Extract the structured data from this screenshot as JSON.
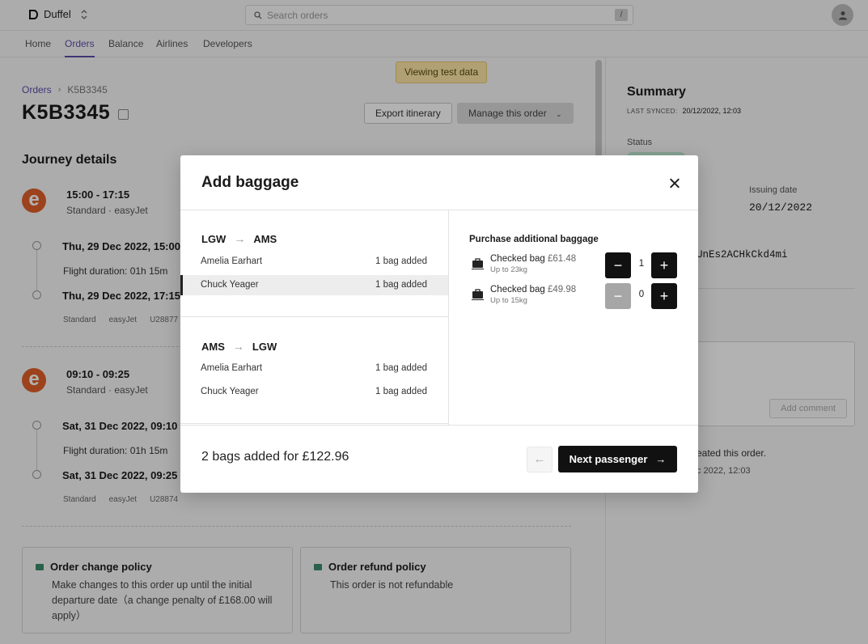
{
  "topbar": {
    "org_name": "Duffel",
    "search_placeholder": "Search orders",
    "search_shortcut": "/"
  },
  "nav": {
    "items": [
      "Home",
      "Orders",
      "Balance",
      "Airlines",
      "Developers"
    ],
    "active": "Orders"
  },
  "banner": "Viewing test data",
  "breadcrumb": {
    "root": "Orders",
    "current": "K5B3345"
  },
  "order": {
    "reference": "K5B3345",
    "export_label": "Export itinerary",
    "manage_label": "Manage this order"
  },
  "journey": {
    "title": "Journey details",
    "slices": [
      {
        "logo_letter": "e",
        "time": "15:00 - 17:15",
        "cabin_airline": "Standard · easyJet",
        "departure": "Thu, 29 Dec 2022, 15:00",
        "duration": "Flight duration: 01h 15m",
        "arrival": "Thu, 29 Dec 2022, 17:15",
        "meta": [
          "Standard",
          "easyJet",
          "U28877"
        ]
      },
      {
        "logo_letter": "e",
        "time": "09:10 - 09:25",
        "cabin_airline": "Standard · easyJet",
        "departure": "Sat, 31 Dec 2022, 09:10",
        "duration": "Flight duration: 01h 15m",
        "arrival": "Sat, 31 Dec 2022, 09:25",
        "meta": [
          "Standard",
          "easyJet",
          "U28874"
        ]
      }
    ]
  },
  "policies": {
    "change": {
      "title": "Order change policy",
      "text": "Make changes to this order up until the initial departure date（a change penalty of £168.00 will apply）"
    },
    "refund": {
      "title": "Order refund policy",
      "text": "This order is not refundable"
    }
  },
  "summary": {
    "title": "Summary",
    "last_synced_label": "LAST SYNCED:",
    "last_synced_value": "20/12/2022, 12:03",
    "status_label": "Status",
    "issuing_label": "Issuing date",
    "issuing_value": "20/12/2022",
    "order_id_partial": "UnEs2ACHkCkd4mi",
    "comment_placeholder": "mment...",
    "add_comment_label": "Add comment",
    "activity_text": "eated this order.",
    "activity_date": "c 2022, 12:03"
  },
  "modal": {
    "title": "Add baggage",
    "segments": [
      {
        "origin": "LGW",
        "destination": "AMS",
        "passengers": [
          {
            "name": "Amelia Earhart",
            "status": "1 bag added",
            "selected": false
          },
          {
            "name": "Chuck Yeager",
            "status": "1 bag added",
            "selected": true
          }
        ]
      },
      {
        "origin": "AMS",
        "destination": "LGW",
        "passengers": [
          {
            "name": "Amelia Earhart",
            "status": "1 bag added",
            "selected": false
          },
          {
            "name": "Chuck Yeager",
            "status": "1 bag added",
            "selected": false
          }
        ]
      }
    ],
    "purchase_heading": "Purchase additional baggage",
    "bags": [
      {
        "name": "Checked bag",
        "price": "£61.48",
        "limit": "Up to 23kg",
        "quantity": "1",
        "minus_disabled": false
      },
      {
        "name": "Checked bag",
        "price": "£49.98",
        "limit": "Up to 15kg",
        "quantity": "0",
        "minus_disabled": true
      }
    ],
    "total_text": "2 bags added for £122.96",
    "back_arrow": "←",
    "next_label": "Next passenger",
    "next_arrow": "→"
  }
}
